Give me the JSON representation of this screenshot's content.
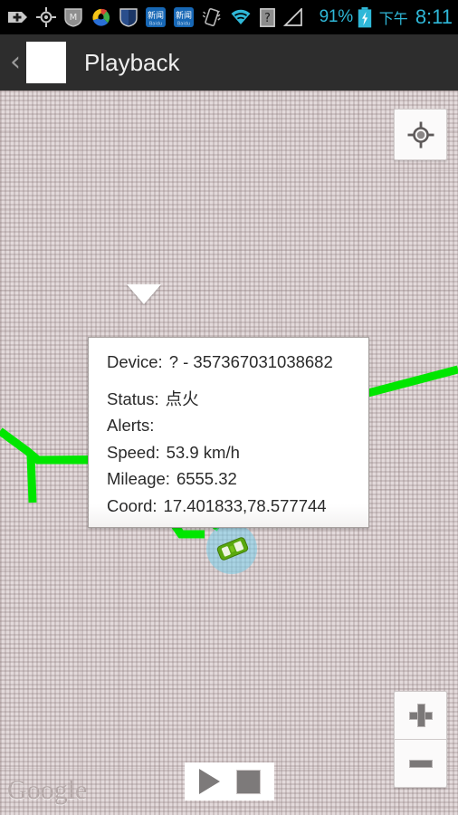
{
  "status_bar": {
    "icons": [
      {
        "name": "add-tag-icon",
        "label": "+"
      },
      {
        "name": "gps-location-icon",
        "label": "GPS"
      },
      {
        "name": "mcafee-icon",
        "label": "M"
      },
      {
        "name": "swirl-app-icon",
        "label": "Swirl"
      },
      {
        "name": "shield-security-icon",
        "label": "Shield"
      },
      {
        "name": "baidu-news-icon-1",
        "label": "新闻"
      },
      {
        "name": "baidu-news-icon-2",
        "label": "新闻"
      },
      {
        "name": "vibrate-mode-icon",
        "label": "Vibrate"
      },
      {
        "name": "wifi-icon",
        "label": "WiFi"
      },
      {
        "name": "unknown-sim-icon",
        "label": "?"
      },
      {
        "name": "signal-strength-icon",
        "label": "Signal"
      }
    ],
    "battery_percent": "91%",
    "battery_charging": true,
    "clock_period": "下午",
    "clock_time": "8:11",
    "accent_color": "#2fb8d8"
  },
  "title_bar": {
    "back_label": "‹",
    "title": "Playback",
    "background_color": "#2d2d2d"
  },
  "map": {
    "background_color": "#e3dadb",
    "route_color": "#00e600",
    "watermark": "Google",
    "my_location_button": "my-location",
    "zoom_in_label": "+",
    "zoom_out_label": "−"
  },
  "info_popup": {
    "rows": [
      {
        "label": "Device:",
        "value": "? - 357367031038682"
      },
      {
        "label": "Status:",
        "value": "点火"
      },
      {
        "label": "Alerts:",
        "value": ""
      },
      {
        "label": "Speed:",
        "value": "53.9 km/h"
      },
      {
        "label": "Mileage:",
        "value": "6555.32"
      },
      {
        "label": "Coord:",
        "value": "17.401833,78.577744"
      }
    ]
  },
  "playback_controls": {
    "play_label": "Play",
    "stop_label": "Stop"
  }
}
